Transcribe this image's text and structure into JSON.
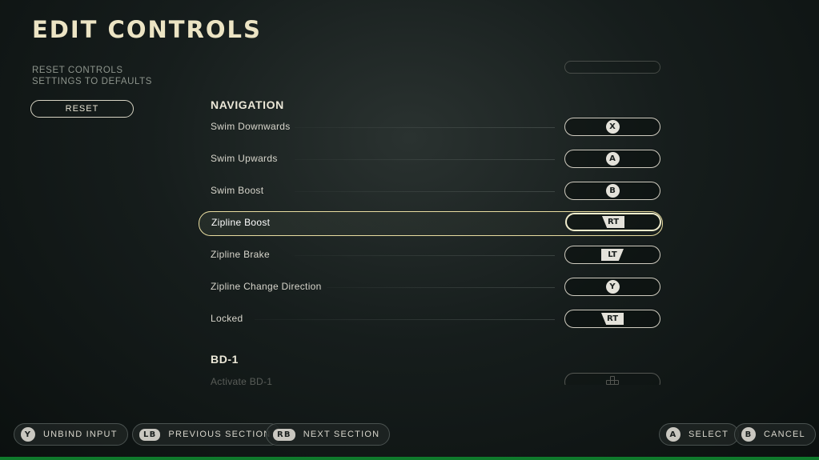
{
  "page": {
    "title": "EDIT CONTROLS"
  },
  "reset": {
    "description_line1": "RESET CONTROLS",
    "description_line2": "SETTINGS TO DEFAULTS",
    "button_label": "RESET"
  },
  "sections": [
    {
      "title": "NAVIGATION",
      "rows": [
        {
          "label": "Swim Downwards",
          "binding": "X",
          "binding_type": "face-button"
        },
        {
          "label": "Swim Upwards",
          "binding": "A",
          "binding_type": "face-button"
        },
        {
          "label": "Swim Boost",
          "binding": "B",
          "binding_type": "face-button"
        },
        {
          "label": "Zipline Boost",
          "binding": "RT",
          "binding_type": "trigger",
          "selected": true
        },
        {
          "label": "Zipline Brake",
          "binding": "LT",
          "binding_type": "trigger"
        },
        {
          "label": "Zipline Change Direction",
          "binding": "Y",
          "binding_type": "face-button"
        },
        {
          "label": "Locked",
          "binding": "RT",
          "binding_type": "trigger"
        }
      ]
    },
    {
      "title": "BD-1",
      "rows": [
        {
          "label": "Activate BD-1",
          "binding": "",
          "binding_type": "dpad-icon"
        }
      ]
    }
  ],
  "footer": {
    "unbind": {
      "glyph": "Y",
      "label": "UNBIND INPUT"
    },
    "previous": {
      "glyph": "LB",
      "label": "PREVIOUS SECTION"
    },
    "next": {
      "glyph": "RB",
      "label": "NEXT SECTION"
    },
    "select": {
      "glyph": "A",
      "label": "SELECT"
    },
    "cancel": {
      "glyph": "B",
      "label": "CANCEL"
    }
  },
  "colors": {
    "accent": "#e8dca0",
    "bottom_bar": "#0f7a2c",
    "title": "#ece4c4"
  }
}
